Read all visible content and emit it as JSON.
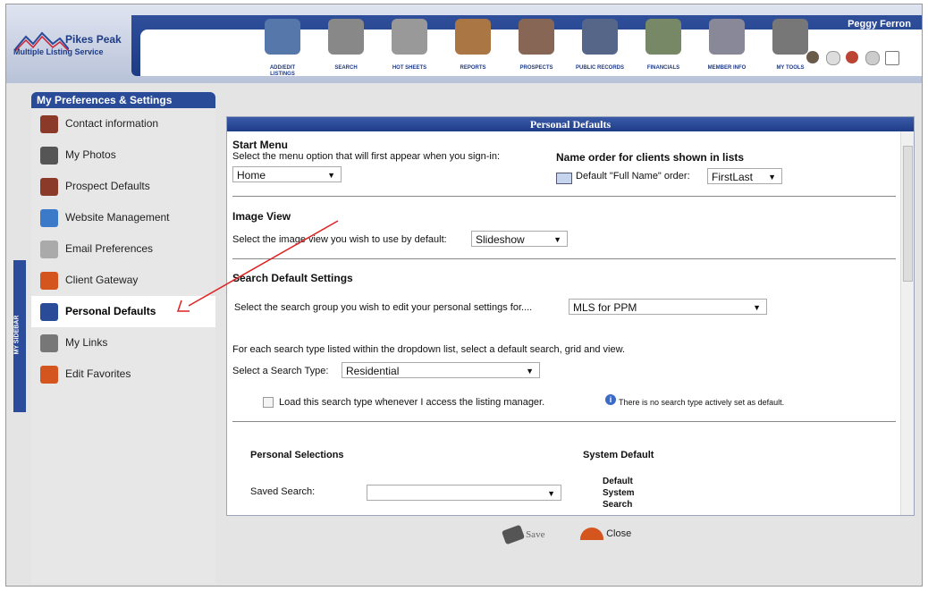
{
  "user": "Peggy Ferron",
  "logo": {
    "line1": "Pikes Peak",
    "line2": "Multiple Listing Service"
  },
  "nav": [
    {
      "label": "ADD/EDIT LISTINGS",
      "icon": "add-edit-listings-icon",
      "color": "#5577aa"
    },
    {
      "label": "SEARCH",
      "icon": "magnifier-icon",
      "color": "#888888"
    },
    {
      "label": "HOT SHEETS",
      "icon": "newspaper-icon",
      "color": "#999999"
    },
    {
      "label": "REPORTS",
      "icon": "house-report-icon",
      "color": "#aa7744"
    },
    {
      "label": "PROSPECTS",
      "icon": "prospects-icon",
      "color": "#886655"
    },
    {
      "label": "PUBLIC RECORDS",
      "icon": "building-icon",
      "color": "#556688"
    },
    {
      "label": "FINANCIALS",
      "icon": "calculator-icon",
      "color": "#778866"
    },
    {
      "label": "MEMBER INFO",
      "icon": "rolodex-icon",
      "color": "#888899"
    },
    {
      "label": "MY TOOLS",
      "icon": "tools-icon",
      "color": "#777777"
    }
  ],
  "sidebar": {
    "tab": "MY SIDEBAR",
    "title": "My Preferences & Settings",
    "items": [
      {
        "label": "Contact information",
        "icon": "contact-icon"
      },
      {
        "label": "My Photos",
        "icon": "photos-icon"
      },
      {
        "label": "Prospect Defaults",
        "icon": "prospect-icon"
      },
      {
        "label": "Website Management",
        "icon": "globe-icon"
      },
      {
        "label": "Email Preferences",
        "icon": "email-icon"
      },
      {
        "label": "Client Gateway",
        "icon": "gateway-icon"
      },
      {
        "label": "Personal Defaults",
        "icon": "defaults-icon"
      },
      {
        "label": "My Links",
        "icon": "links-icon"
      },
      {
        "label": "Edit Favorites",
        "icon": "favorites-icon"
      }
    ]
  },
  "panel": {
    "title": "Personal Defaults",
    "start_menu": {
      "heading": "Start Menu",
      "desc": "Select the menu option that will first appear when you sign-in:",
      "value": "Home"
    },
    "name_order": {
      "heading": "Name order for clients shown in lists",
      "label": "Default \"Full Name\" order:",
      "value": "FirstLast"
    },
    "image_view": {
      "heading": "Image View",
      "desc": "Select the image view you wish to use by default:",
      "value": "Slideshow"
    },
    "search_defaults": {
      "heading": "Search Default Settings",
      "group_desc": "Select the search group you wish to edit your personal settings for....",
      "group_value": "MLS for PPM",
      "type_desc": "For each search type listed within the dropdown list, select a default search, grid and view.",
      "type_label": "Select a Search Type:",
      "type_value": "Residential",
      "load_label": "Load this search type whenever I access the listing manager.",
      "info": "There is no search type actively set as default."
    },
    "personal": {
      "heading": "Personal Selections",
      "system_heading": "System Default",
      "saved_search_label": "Saved Search:",
      "saved_search_value": "",
      "system_value_1": "Default",
      "system_value_2": "System",
      "system_value_3": "Search"
    }
  },
  "buttons": {
    "save": "Save",
    "close": "Close"
  }
}
